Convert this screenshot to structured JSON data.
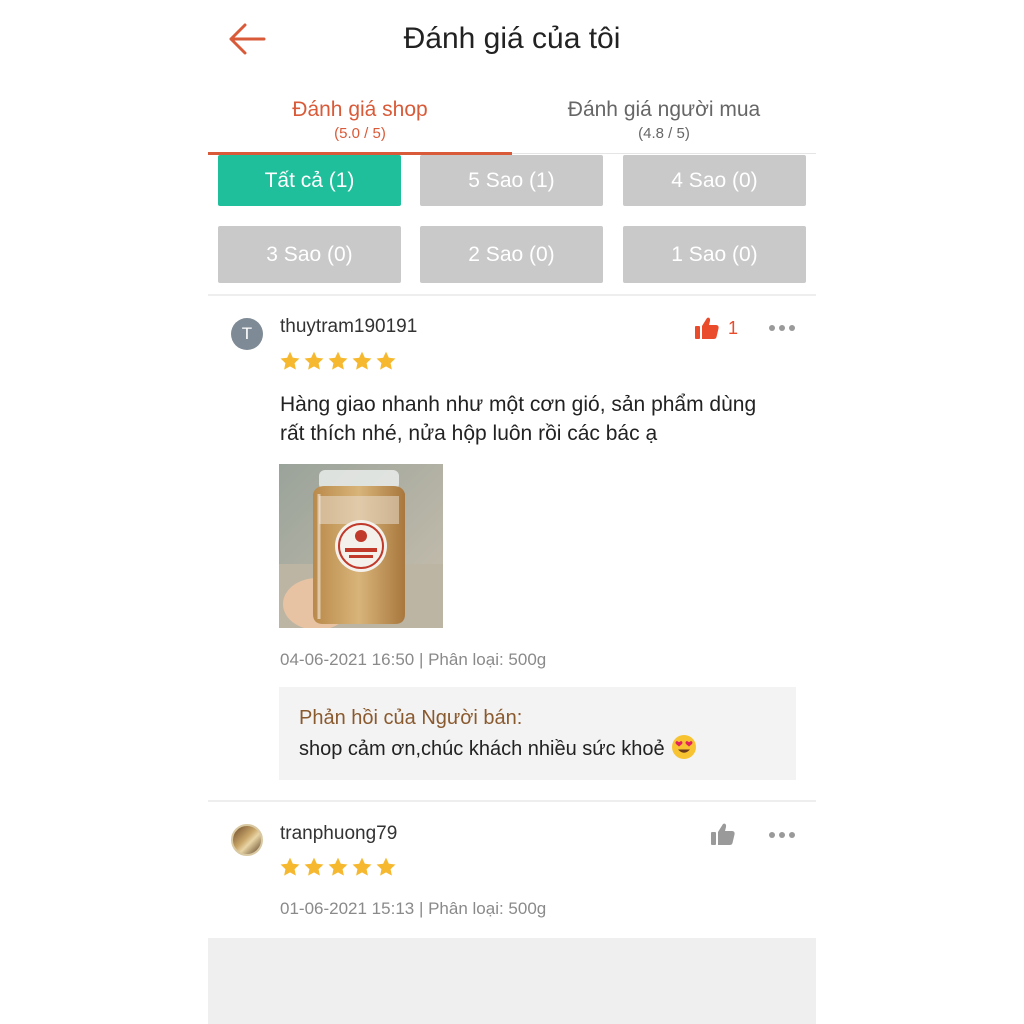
{
  "header": {
    "title": "Đánh giá của tôi"
  },
  "tabs": [
    {
      "label": "Đánh giá shop",
      "sub": "(5.0 / 5)",
      "active": true
    },
    {
      "label": "Đánh giá người mua",
      "sub": "(4.8 / 5)",
      "active": false
    }
  ],
  "filters": [
    {
      "label": "Tất cả (1)",
      "active": true
    },
    {
      "label": "5 Sao (1)",
      "active": false
    },
    {
      "label": "4 Sao (0)",
      "active": false
    },
    {
      "label": "3 Sao (0)",
      "active": false
    },
    {
      "label": "2 Sao (0)",
      "active": false
    },
    {
      "label": "1 Sao (0)",
      "active": false
    }
  ],
  "reviews": [
    {
      "avatar_letter": "T",
      "username": "thuytram190191",
      "rating": 5,
      "likes": "1",
      "text": "Hàng giao nhanh như một cơn gió, sản phẩm dùng rất thích nhé, nửa hộp luôn rồi các bác ạ",
      "meta": "04-06-2021 16:50 | Phân loại: 500g",
      "seller_reply_title": "Phản hồi của Người bán:",
      "seller_reply_text": "shop cảm ơn,chúc khách nhiều sức khoẻ"
    },
    {
      "username": "tranphuong79",
      "rating": 5,
      "meta": "01-06-2021 15:13 | Phân loại: 500g"
    }
  ],
  "colors": {
    "accent": "#d95a38",
    "filter_active": "#1fbf9b",
    "filter_inactive": "#c9c9c9",
    "star": "#f6b82e",
    "like_active": "#e94b2b",
    "like_inactive": "#9a9a9a",
    "reply_title": "#8a5a2f"
  },
  "icons": {
    "back": "arrow-left-icon",
    "like": "thumbs-up-icon",
    "more": "more-horizontal-icon",
    "star": "star-icon",
    "emoji": "heart-eyes-emoji-icon"
  }
}
